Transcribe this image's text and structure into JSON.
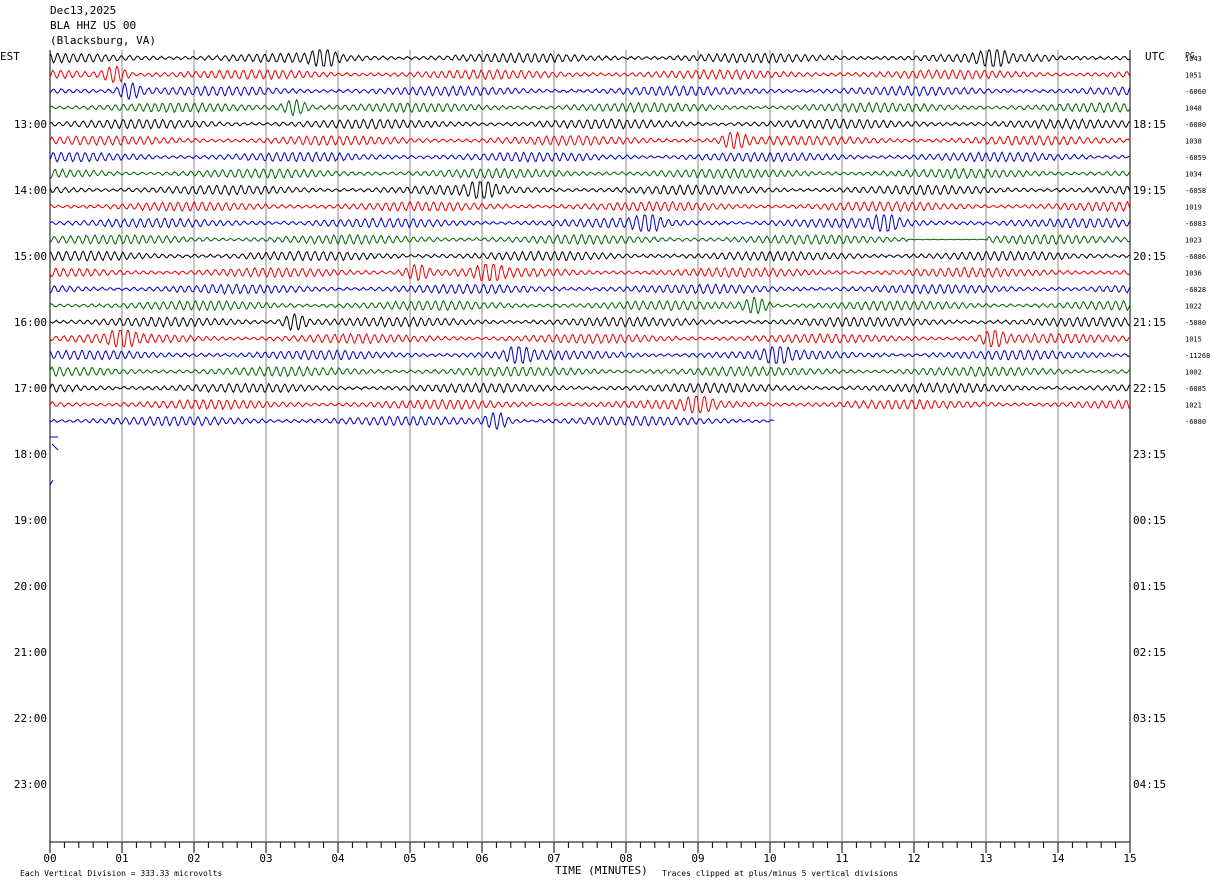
{
  "header": {
    "date": "Dec13,2025",
    "station": "BLA HHZ US 00",
    "location": "(Blacksburg, VA)"
  },
  "left_axis_title": "EST",
  "right_axis_title": "UTC",
  "right_corner_label": "PG",
  "footer": {
    "scale_note": "Each Vertical Division =  333.33 microvolts",
    "xlabel": "TIME (MINUTES)",
    "clip_note": "Traces clipped at plus/minus 5 vertical divisions"
  },
  "trace_colors": [
    "#000000",
    "#ee0000",
    "#0000cc",
    "#006600"
  ],
  "chart_data": {
    "type": "line",
    "xlabel": "TIME (MINUTES)",
    "x_ticks": [
      "00",
      "01",
      "02",
      "03",
      "04",
      "05",
      "06",
      "07",
      "08",
      "09",
      "10",
      "11",
      "12",
      "13",
      "14",
      "15"
    ],
    "xlim": [
      0,
      15
    ],
    "left_hour_labels": [
      "13:00",
      "14:00",
      "15:00",
      "16:00",
      "17:00",
      "18:00",
      "19:00",
      "20:00",
      "21:00",
      "22:00",
      "23:00"
    ],
    "right_hour_labels": [
      "18:15",
      "19:15",
      "20:15",
      "21:15",
      "22:15",
      "23:15",
      "00:15",
      "01:15",
      "02:15",
      "03:15",
      "04:15"
    ],
    "rows_per_hour": 4,
    "trace_offsets": [
      "1043",
      "1051",
      "-6060",
      "1048",
      "-6080",
      "1038",
      "-6059",
      "1034",
      "-6058",
      "1019",
      "-6083",
      "1023",
      "-6086",
      "1036",
      "-6028",
      "1022",
      "-5880",
      "1015",
      "-11268",
      "1002",
      "-6085",
      "1021",
      "-6080"
    ],
    "trace_end_minutes": [
      15,
      15,
      15,
      15,
      15,
      15,
      15,
      15,
      15,
      15,
      15,
      15,
      15,
      15,
      15,
      15,
      15,
      15,
      15,
      15,
      15,
      15,
      10.05
    ],
    "gap": {
      "row": 11,
      "from_minute": 11.9,
      "to_minute": 13.0
    },
    "amplitude_bursts": [
      {
        "row": 0,
        "minute": 3.8
      },
      {
        "row": 0,
        "minute": 13.1
      },
      {
        "row": 1,
        "minute": 0.9
      },
      {
        "row": 2,
        "minute": 1.1
      },
      {
        "row": 3,
        "minute": 3.4
      },
      {
        "row": 5,
        "minute": 9.5
      },
      {
        "row": 8,
        "minute": 6.0
      },
      {
        "row": 10,
        "minute": 8.3
      },
      {
        "row": 10,
        "minute": 11.6
      },
      {
        "row": 13,
        "minute": 5.1
      },
      {
        "row": 13,
        "minute": 6.1
      },
      {
        "row": 15,
        "minute": 9.8
      },
      {
        "row": 16,
        "minute": 3.4
      },
      {
        "row": 17,
        "minute": 1.0
      },
      {
        "row": 17,
        "minute": 13.1
      },
      {
        "row": 18,
        "minute": 6.5
      },
      {
        "row": 18,
        "minute": 10.1
      },
      {
        "row": 21,
        "minute": 9.0
      },
      {
        "row": 22,
        "minute": 6.2
      }
    ],
    "note_scale": "Each Vertical Division =  333.33 microvolts",
    "note_clip": "Traces clipped at plus/minus 5 vertical divisions",
    "grid": true
  }
}
